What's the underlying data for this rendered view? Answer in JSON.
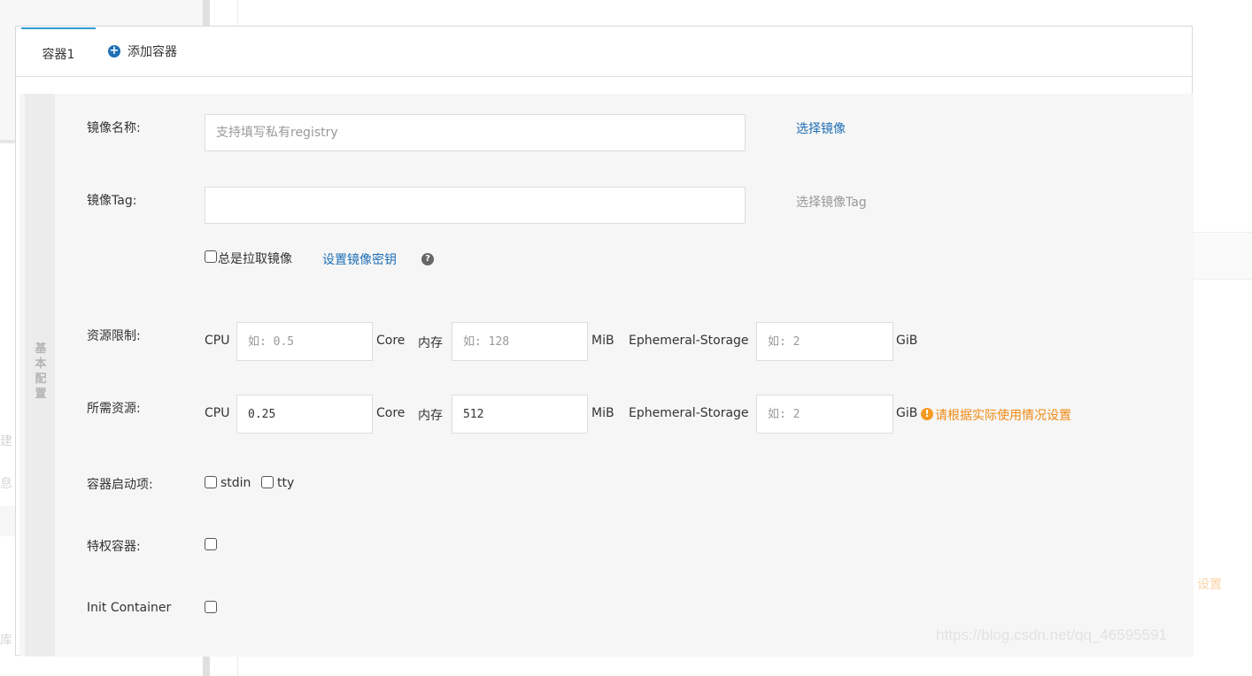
{
  "tabs": {
    "active_label": "容器1",
    "add_label": "添加容器",
    "add_icon": "plus-circle-icon"
  },
  "side_label": "基本配置",
  "image": {
    "name_label": "镜像名称:",
    "name_placeholder": "支持填写私有registry",
    "select_image": "选择镜像",
    "tag_label": "镜像Tag:",
    "tag_value": "",
    "select_tag": "选择镜像Tag",
    "always_pull": "总是拉取镜像",
    "set_secret": "设置镜像密钥",
    "help_icon": "question-circle-icon"
  },
  "limits": {
    "label": "资源限制:",
    "cpu": "CPU",
    "cpu_placeholder": "如: 0.5",
    "core": "Core",
    "mem": "内存",
    "mem_placeholder": "如: 128",
    "mib": "MiB",
    "eph": "Ephemeral-Storage",
    "eph_placeholder": "如: 2",
    "gib": "GiB"
  },
  "requests": {
    "label": "所需资源:",
    "cpu": "CPU",
    "cpu_value": "0.25",
    "core": "Core",
    "mem": "内存",
    "mem_value": "512",
    "mib": "MiB",
    "eph": "Ephemeral-Storage",
    "eph_placeholder": "如: 2",
    "gib": "GiB",
    "warn_icon": "exclamation-circle-icon",
    "warn_text": "请根据实际使用情况设置",
    "warn_color": "#f08a13"
  },
  "startup": {
    "label": "容器启动项:",
    "stdin": "stdin",
    "tty": "tty"
  },
  "privileged": {
    "label": "特权容器:"
  },
  "init": {
    "label": "Init Container"
  },
  "watermark": "https://blog.csdn.net/qq_46595591",
  "background": {
    "left_text_1": "建",
    "left_text_2": "息",
    "left_text_3": "库",
    "right_text": "设置"
  },
  "colors": {
    "accent": "#2e9bd6",
    "link": "#1f6fb5"
  }
}
